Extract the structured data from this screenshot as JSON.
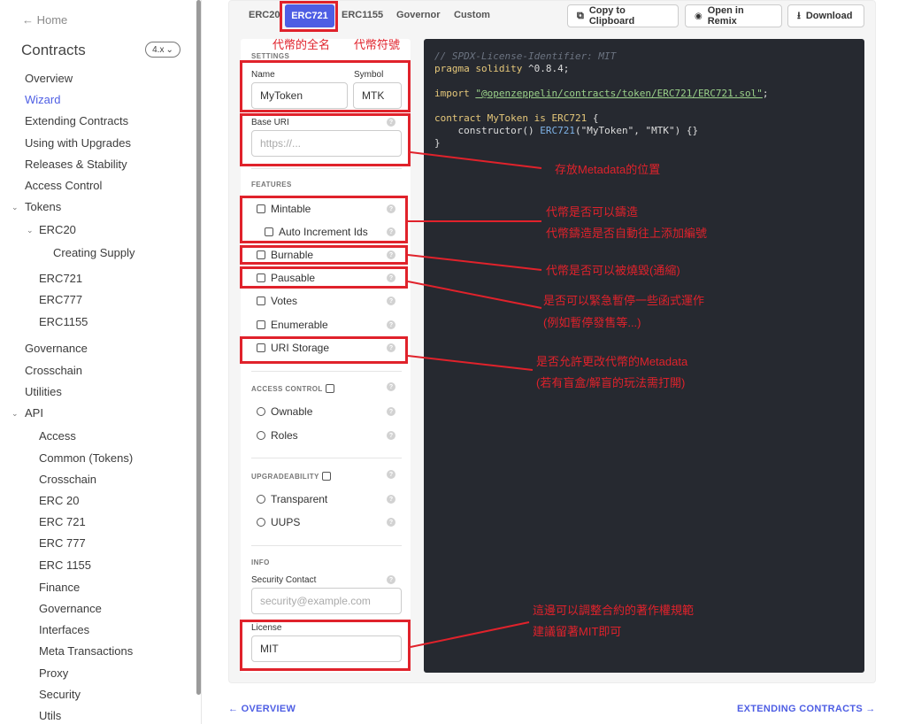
{
  "sidebar": {
    "home": "← Home",
    "title": "Contracts",
    "version": "4.x",
    "items": [
      {
        "label": "Overview"
      },
      {
        "label": "Wizard"
      },
      {
        "label": "Extending Contracts"
      },
      {
        "label": "Using with Upgrades"
      },
      {
        "label": "Releases & Stability"
      },
      {
        "label": "Access Control"
      },
      {
        "label": "Tokens"
      },
      {
        "label": "ERC20"
      },
      {
        "label": "Creating Supply"
      },
      {
        "label": "ERC721"
      },
      {
        "label": "ERC777"
      },
      {
        "label": "ERC1155"
      },
      {
        "label": "Governance"
      },
      {
        "label": "Crosschain"
      },
      {
        "label": "Utilities"
      },
      {
        "label": "API"
      },
      {
        "label": "Access"
      },
      {
        "label": "Common (Tokens)"
      },
      {
        "label": "Crosschain"
      },
      {
        "label": "ERC 20"
      },
      {
        "label": "ERC 721"
      },
      {
        "label": "ERC 777"
      },
      {
        "label": "ERC 1155"
      },
      {
        "label": "Finance"
      },
      {
        "label": "Governance"
      },
      {
        "label": "Interfaces"
      },
      {
        "label": "Meta Transactions"
      },
      {
        "label": "Proxy"
      },
      {
        "label": "Security"
      },
      {
        "label": "Utils"
      }
    ]
  },
  "tabs": [
    "ERC20",
    "ERC721",
    "ERC1155",
    "Governor",
    "Custom"
  ],
  "toolbar": {
    "copy": "Copy to Clipboard",
    "remix": "Open in Remix",
    "download": "Download"
  },
  "settings": {
    "section": "SETTINGS",
    "name_label": "Name",
    "name_value": "MyToken",
    "symbol_label": "Symbol",
    "symbol_value": "MTK",
    "base_uri_label": "Base URI",
    "base_uri_placeholder": "https://..."
  },
  "features": {
    "section": "FEATURES",
    "mintable": "Mintable",
    "auto_increment": "Auto Increment Ids",
    "burnable": "Burnable",
    "pausable": "Pausable",
    "votes": "Votes",
    "enumerable": "Enumerable",
    "uri_storage": "URI Storage"
  },
  "access_control": {
    "section": "ACCESS CONTROL",
    "ownable": "Ownable",
    "roles": "Roles"
  },
  "upgradeability": {
    "section": "UPGRADEABILITY",
    "transparent": "Transparent",
    "uups": "UUPS"
  },
  "info": {
    "section": "INFO",
    "security_label": "Security Contact",
    "security_placeholder": "security@example.com",
    "license_label": "License",
    "license_value": "MIT"
  },
  "code": {
    "comment": "// SPDX-License-Identifier: MIT",
    "pragma_kw": "pragma solidity",
    "pragma_ver": " ^0.8.4;",
    "import_kw": "import ",
    "import_path": "\"@openzeppelin/contracts/token/ERC721/ERC721.sol\"",
    "import_end": ";",
    "contract_kw": "contract ",
    "contract_name": "MyToken",
    "is_kw": " is ",
    "base": "ERC721",
    "open_brace": " {",
    "ctor_indent": "    ",
    "ctor": "constructor",
    "ctor_args": "() ",
    "ctor_base": "ERC721",
    "ctor_open": "(",
    "arg1": "\"MyToken\"",
    "comma": ", ",
    "arg2": "\"MTK\"",
    "ctor_close": ") {}",
    "close_brace": "}"
  },
  "annotations": {
    "fullname": "代幣的全名",
    "symbol": "代幣符號",
    "metadata": "存放Metadata的位置",
    "mint1": "代幣是否可以鑄造",
    "mint2": "代幣鑄造是否自動往上添加編號",
    "burn": "代幣是否可以被燒毀(通縮)",
    "pause1": "是否可以緊急暫停一些函式運作",
    "pause2": "(例如暫停發售等...)",
    "uri1": "是否允許更改代幣的Metadata",
    "uri2": "(若有盲盒/解盲的玩法需打開)",
    "license1": "這邊可以調整合約的著作權規範",
    "license2": "建議留著MIT即可"
  },
  "footer": {
    "prev": "← OVERVIEW",
    "next": "EXTENDING CONTRACTS →"
  }
}
